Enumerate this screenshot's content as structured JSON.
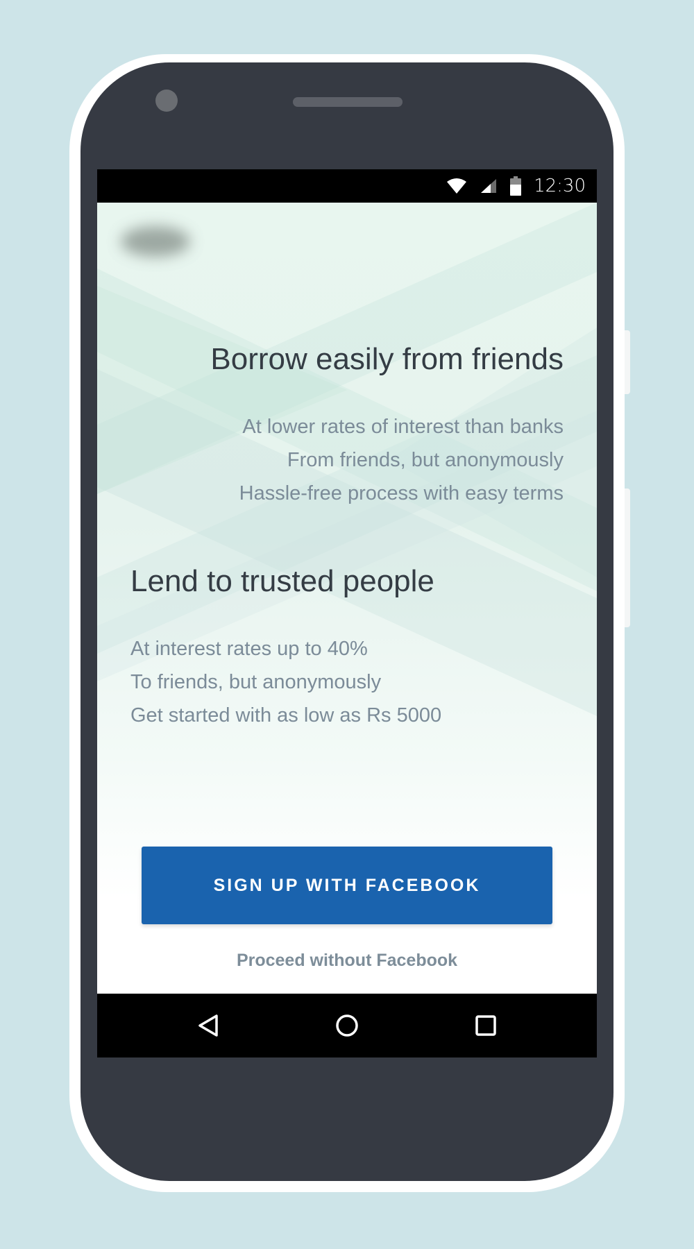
{
  "status_bar": {
    "time": "12:30"
  },
  "borrow": {
    "title": "Borrow easily from friends",
    "lines": [
      "At lower rates of interest than banks",
      "From friends, but anonymously",
      "Hassle-free process with easy terms"
    ]
  },
  "lend": {
    "title": "Lend to trusted people",
    "lines": [
      "At interest rates up to 40%",
      "To friends, but anonymously",
      "Get started with as low as Rs 5000"
    ]
  },
  "actions": {
    "facebook_button": "SIGN UP WITH FACEBOOK",
    "proceed_link": "Proceed without Facebook"
  },
  "icons": {
    "status": [
      "wifi-icon",
      "signal-icon",
      "battery-icon"
    ],
    "navigation": [
      "back-icon",
      "home-icon",
      "recent-apps-icon"
    ]
  },
  "colors": {
    "background": "#cde4e8",
    "phone_body": "#363a43",
    "button": "#1a63ae",
    "title_text": "#343c44",
    "body_text": "#7b8b98"
  }
}
